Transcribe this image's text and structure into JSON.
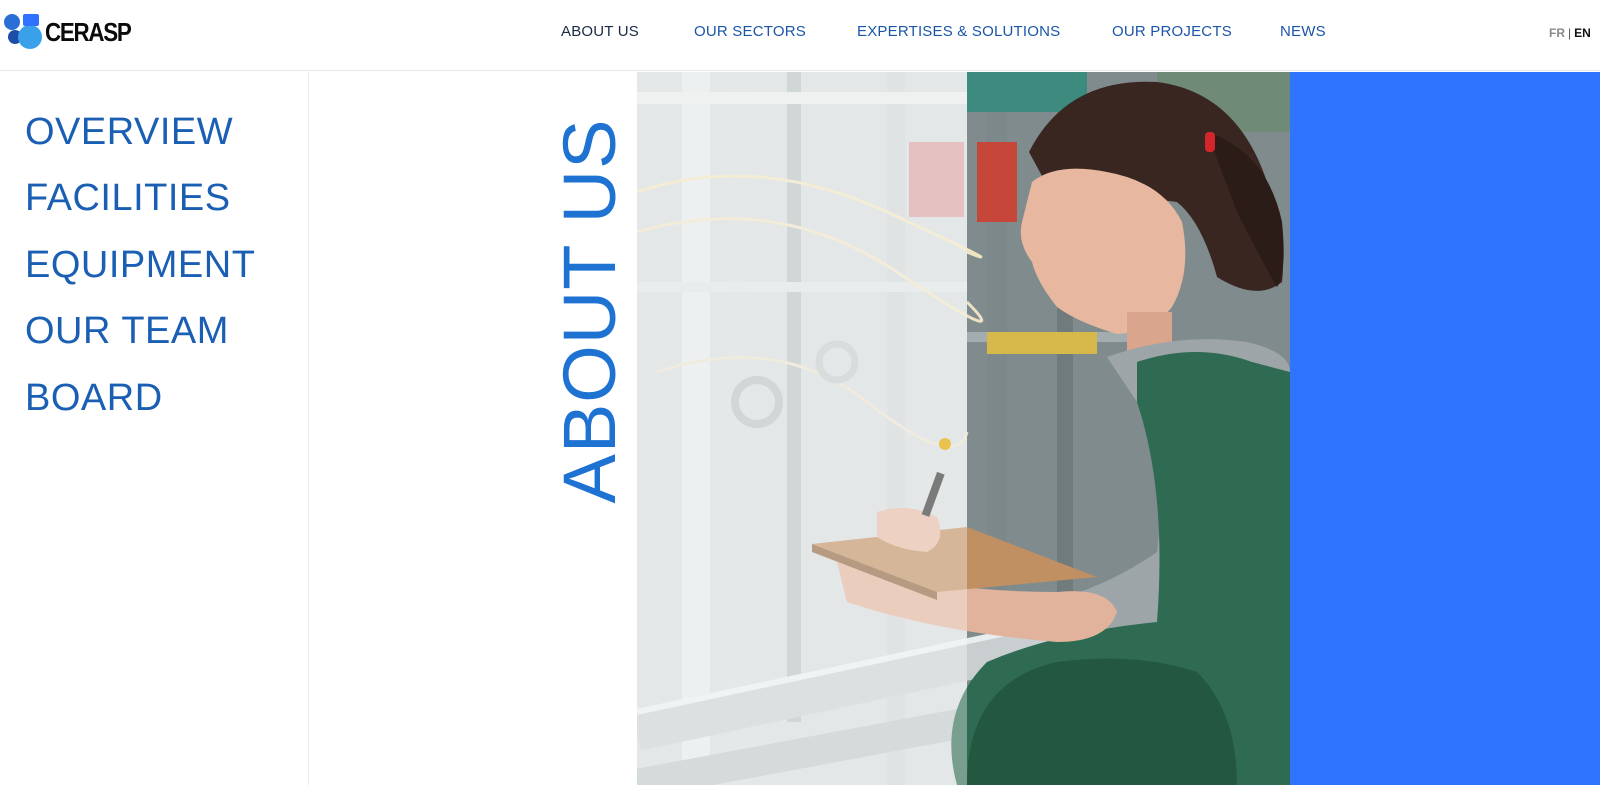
{
  "brand": {
    "name": "CERASP"
  },
  "nav": {
    "items": [
      {
        "label": "ABOUT US",
        "active": true
      },
      {
        "label": "OUR SECTORS",
        "active": false
      },
      {
        "label": "EXPERTISES & SOLUTIONS",
        "active": false
      },
      {
        "label": "OUR PROJECTS",
        "active": false
      },
      {
        "label": "NEWS",
        "active": false
      }
    ]
  },
  "language": {
    "fr": "FR",
    "separator": "|",
    "en": "EN",
    "selected": "EN"
  },
  "sidebar": {
    "items": [
      {
        "label": "OVERVIEW"
      },
      {
        "label": "FACILITIES"
      },
      {
        "label": "EQUIPMENT"
      },
      {
        "label": "OUR TEAM"
      },
      {
        "label": "BOARD"
      }
    ]
  },
  "hero": {
    "title": "ABOUT US"
  },
  "colors": {
    "accent_blue": "#2f74ff",
    "title_blue": "#1e72d2",
    "nav_blue": "#1a55a8",
    "sidebar_blue": "#1a5fb4"
  },
  "icons": {
    "logo": "cerasp-logo-icon"
  }
}
